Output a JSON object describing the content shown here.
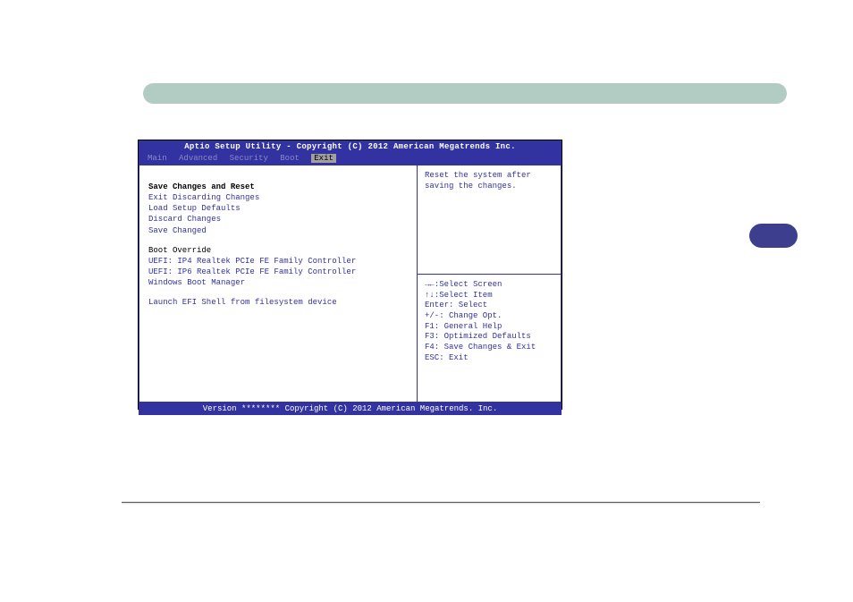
{
  "bios": {
    "title": "Aptio Setup Utility - Copyright (C) 2012 American Megatrends Inc.",
    "tabs": {
      "main": "Main",
      "advanced": "Advanced",
      "security": "Security",
      "boot": "Boot",
      "exit": "Exit"
    },
    "exit_menu": {
      "save_reset": "Save Changes and Reset",
      "exit_discard": "Exit Discarding Changes",
      "load_defaults": "Load Setup Defaults",
      "discard": "Discard Changes",
      "save_changed": "Save Changed"
    },
    "boot_override": {
      "label": "Boot Override",
      "uefi_ip4": "UEFI: IP4 Realtek PCIe FE Family Controller",
      "uefi_ip6": "UEFI: IP6 Realtek PCIe FE Family Controller",
      "win_boot": "Windows Boot Manager"
    },
    "launch_efi": "Launch EFI Shell from filesystem device",
    "help": {
      "selected_desc": "Reset the system after saving the changes.",
      "select_screen": "→←:Select Screen",
      "select_item": "↑↓:Select Item",
      "enter": "Enter: Select",
      "change_opt": "+/-: Change Opt.",
      "f1": "F1: General Help",
      "f3": "F3: Optimized Defaults",
      "f4": "F4: Save Changes & Exit",
      "esc": "ESC: Exit"
    },
    "footer": "Version ******** Copyright (C) 2012 American Megatrends. Inc."
  }
}
